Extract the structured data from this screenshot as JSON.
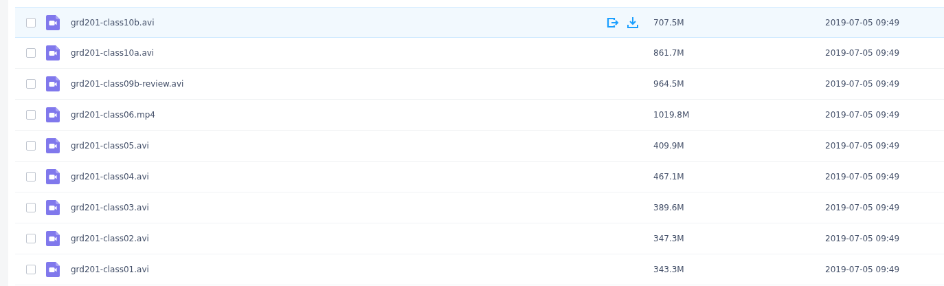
{
  "files": [
    {
      "name": "grd201-class10b.avi",
      "size": "707.5M",
      "modified": "2019-07-05 09:49",
      "checked": false,
      "hovered": true
    },
    {
      "name": "grd201-class10a.avi",
      "size": "861.7M",
      "modified": "2019-07-05 09:49",
      "checked": false,
      "hovered": false
    },
    {
      "name": "grd201-class09b-review.avi",
      "size": "964.5M",
      "modified": "2019-07-05 09:49",
      "checked": false,
      "hovered": false
    },
    {
      "name": "grd201-class06.mp4",
      "size": "1019.8M",
      "modified": "2019-07-05 09:49",
      "checked": false,
      "hovered": false
    },
    {
      "name": "grd201-class05.avi",
      "size": "409.9M",
      "modified": "2019-07-05 09:49",
      "checked": false,
      "hovered": false
    },
    {
      "name": "grd201-class04.avi",
      "size": "467.1M",
      "modified": "2019-07-05 09:49",
      "checked": false,
      "hovered": false
    },
    {
      "name": "grd201-class03.avi",
      "size": "389.6M",
      "modified": "2019-07-05 09:49",
      "checked": false,
      "hovered": false
    },
    {
      "name": "grd201-class02.avi",
      "size": "347.3M",
      "modified": "2019-07-05 09:49",
      "checked": false,
      "hovered": false
    },
    {
      "name": "grd201-class01.avi",
      "size": "343.3M",
      "modified": "2019-07-05 09:49",
      "checked": false,
      "hovered": false
    }
  ]
}
